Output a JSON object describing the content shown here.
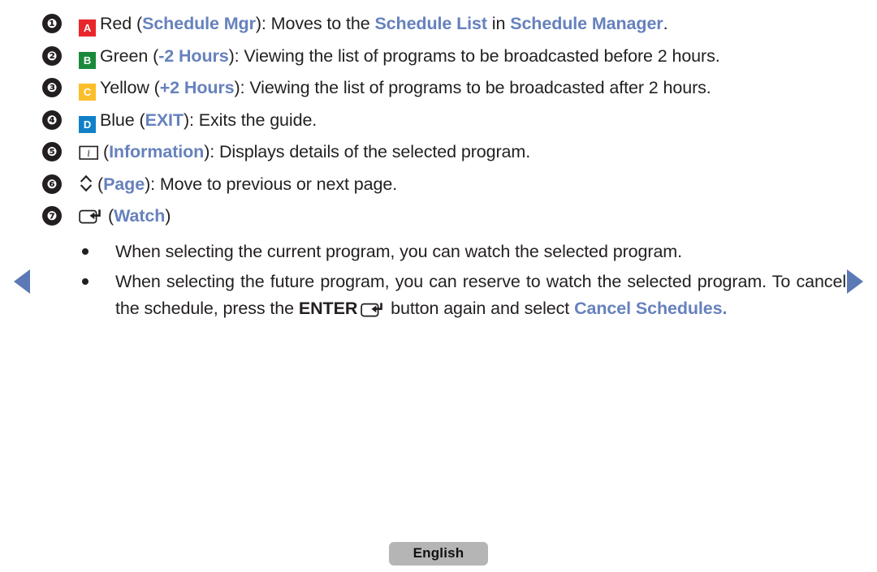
{
  "nav": {
    "prev_icon": "triangle-left-icon",
    "next_icon": "triangle-right-icon",
    "arrow_color": "#5b79b5"
  },
  "items": [
    {
      "number": "❶",
      "index": "1",
      "badge": {
        "letter": "A",
        "color": "#e8262b",
        "name": "red"
      },
      "segments": [
        {
          "text": "Red (",
          "style": "plain"
        },
        {
          "text": "Schedule Mgr",
          "style": "blue-bold"
        },
        {
          "text": "): Moves to the ",
          "style": "plain"
        },
        {
          "text": "Schedule List",
          "style": "blue-bold"
        },
        {
          "text": " in ",
          "style": "plain"
        },
        {
          "text": "Schedule Manager",
          "style": "blue-bold"
        },
        {
          "text": ".",
          "style": "plain"
        }
      ]
    },
    {
      "number": "❷",
      "index": "2",
      "badge": {
        "letter": "B",
        "color": "#1a8a3a",
        "name": "green"
      },
      "segments": [
        {
          "text": "Green (",
          "style": "plain"
        },
        {
          "text": "-2 Hours",
          "style": "blue-bold"
        },
        {
          "text": "): Viewing the list of programs to be broadcasted before 2 hours.",
          "style": "plain"
        }
      ]
    },
    {
      "number": "❸",
      "index": "3",
      "badge": {
        "letter": "C",
        "color": "#fcbe2b",
        "name": "yellow"
      },
      "segments": [
        {
          "text": "Yellow (",
          "style": "plain"
        },
        {
          "text": "+2 Hours",
          "style": "blue-bold"
        },
        {
          "text": "): Viewing the list of programs to be broadcasted after 2 hours.",
          "style": "plain"
        }
      ]
    },
    {
      "number": "❹",
      "index": "4",
      "badge": {
        "letter": "D",
        "color": "#1080c8",
        "name": "blue"
      },
      "segments": [
        {
          "text": "Blue (",
          "style": "plain"
        },
        {
          "text": "EXIT",
          "style": "blue-bold"
        },
        {
          "text": "): Exits the guide.",
          "style": "plain"
        }
      ]
    },
    {
      "number": "❺",
      "index": "5",
      "icon": "info-key-icon",
      "segments": [
        {
          "text": "(",
          "style": "plain"
        },
        {
          "text": "Information",
          "style": "blue-bold"
        },
        {
          "text": "): Displays details of the selected program.",
          "style": "plain"
        }
      ]
    },
    {
      "number": "❻",
      "index": "6",
      "icon": "page-updown-icon",
      "segments": [
        {
          "text": "(",
          "style": "plain"
        },
        {
          "text": "Page",
          "style": "blue-bold"
        },
        {
          "text": "): Move to previous or next page.",
          "style": "plain"
        }
      ]
    },
    {
      "number": "❼",
      "index": "7",
      "icon": "enter-key-icon",
      "segments": [
        {
          "text": "(",
          "style": "plain"
        },
        {
          "text": "Watch",
          "style": "blue-bold"
        },
        {
          "text": ")",
          "style": "plain"
        }
      ]
    }
  ],
  "bullets": [
    {
      "segments": [
        {
          "text": "When selecting the current program, you can watch the selected program.",
          "style": "plain"
        }
      ]
    },
    {
      "segments": [
        {
          "text": "When selecting the future program, you can reserve to watch the selected program. To cancel the schedule, press the ",
          "style": "plain"
        },
        {
          "text": "ENTER",
          "style": "black-bold"
        },
        {
          "text": "enter-key-icon",
          "style": "icon"
        },
        {
          "text": " button again and select ",
          "style": "plain"
        },
        {
          "text": "Cancel Schedules.",
          "style": "blue-bold"
        }
      ]
    }
  ],
  "footer": {
    "language_label": "English"
  },
  "colors": {
    "accent_blue": "#6681bd",
    "text": "#231f20",
    "badge_red": "#e8262b",
    "badge_green": "#1a8a3a",
    "badge_yellow": "#fcbe2b",
    "badge_blue": "#1080c8",
    "footer_pill": "#b5b5b5"
  }
}
